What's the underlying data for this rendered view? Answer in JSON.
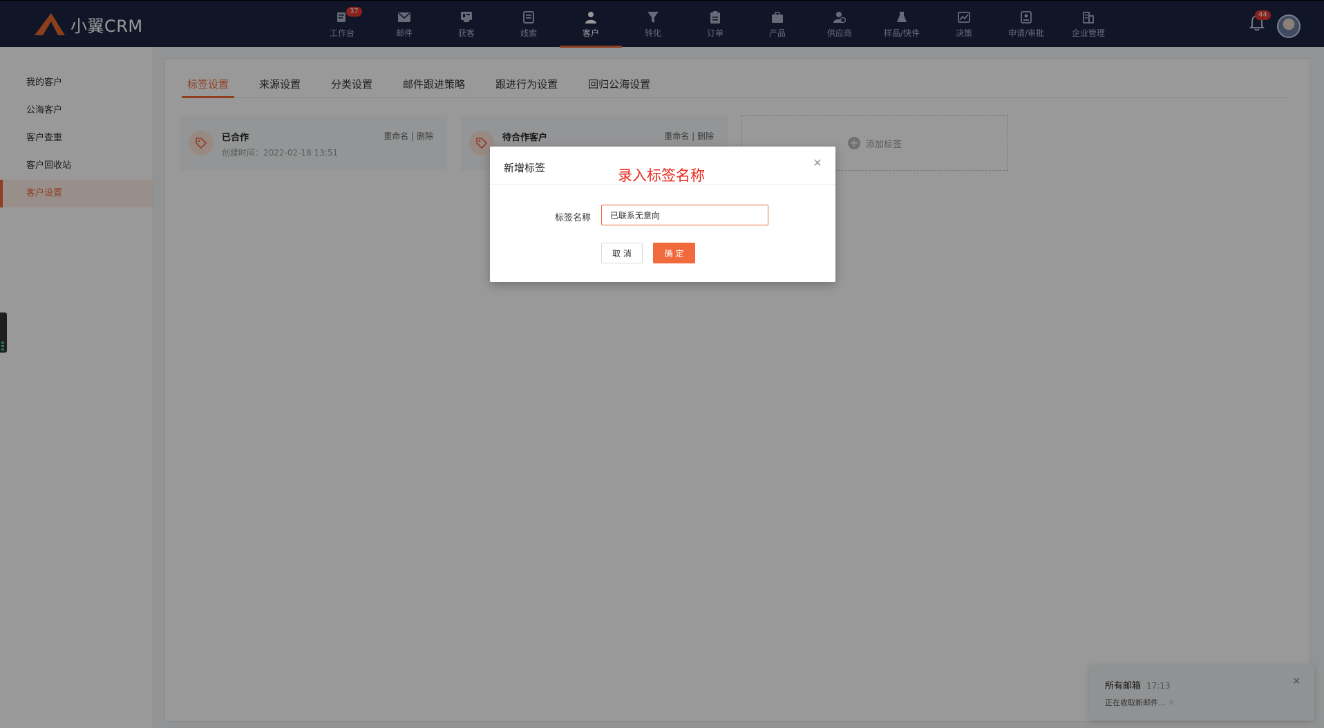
{
  "app": {
    "logo_text": "小翼CRM"
  },
  "nav": {
    "items": [
      {
        "label": "工作台",
        "icon": "workbench-icon",
        "badge": "37"
      },
      {
        "label": "邮件",
        "icon": "mail-icon"
      },
      {
        "label": "获客",
        "icon": "acquire-icon"
      },
      {
        "label": "线索",
        "icon": "leads-icon"
      },
      {
        "label": "客户",
        "icon": "customer-icon",
        "active": true
      },
      {
        "label": "转化",
        "icon": "funnel-icon"
      },
      {
        "label": "订单",
        "icon": "order-icon"
      },
      {
        "label": "产品",
        "icon": "product-icon"
      },
      {
        "label": "供应商",
        "icon": "supplier-icon"
      },
      {
        "label": "样品/快件",
        "icon": "sample-icon"
      },
      {
        "label": "决策",
        "icon": "decision-icon"
      },
      {
        "label": "申请/审批",
        "icon": "approval-icon"
      },
      {
        "label": "企业管理",
        "icon": "company-icon"
      }
    ],
    "bell_badge": "44"
  },
  "sidebar": {
    "items": [
      {
        "label": "我的客户"
      },
      {
        "label": "公海客户"
      },
      {
        "label": "客户查重"
      },
      {
        "label": "客户回收站"
      },
      {
        "label": "客户设置",
        "active": true
      }
    ]
  },
  "tabs": [
    {
      "label": "标签设置",
      "active": true
    },
    {
      "label": "来源设置"
    },
    {
      "label": "分类设置"
    },
    {
      "label": "邮件跟进策略"
    },
    {
      "label": "跟进行为设置"
    },
    {
      "label": "回归公海设置"
    }
  ],
  "tag_cards": [
    {
      "name": "已合作",
      "created": "创建时间：2022-02-18 13:51",
      "rename": "重命名",
      "delete": "删除"
    },
    {
      "name": "待合作客户",
      "created": "",
      "rename": "重命名",
      "delete": "删除"
    }
  ],
  "add_tag_label": "添加标签",
  "modal": {
    "title": "新增标签",
    "field_label": "标签名称",
    "field_value": "已联系无意向",
    "cancel_label": "取 消",
    "confirm_label": "确 定"
  },
  "annotation": "录入标签名称",
  "notification": {
    "title": "所有邮箱",
    "time": "17:13",
    "text": "正在收取新邮件..."
  },
  "colors": {
    "accent": "#f06a3b",
    "topbar": "#1c2444",
    "annotation": "#e8291c"
  }
}
